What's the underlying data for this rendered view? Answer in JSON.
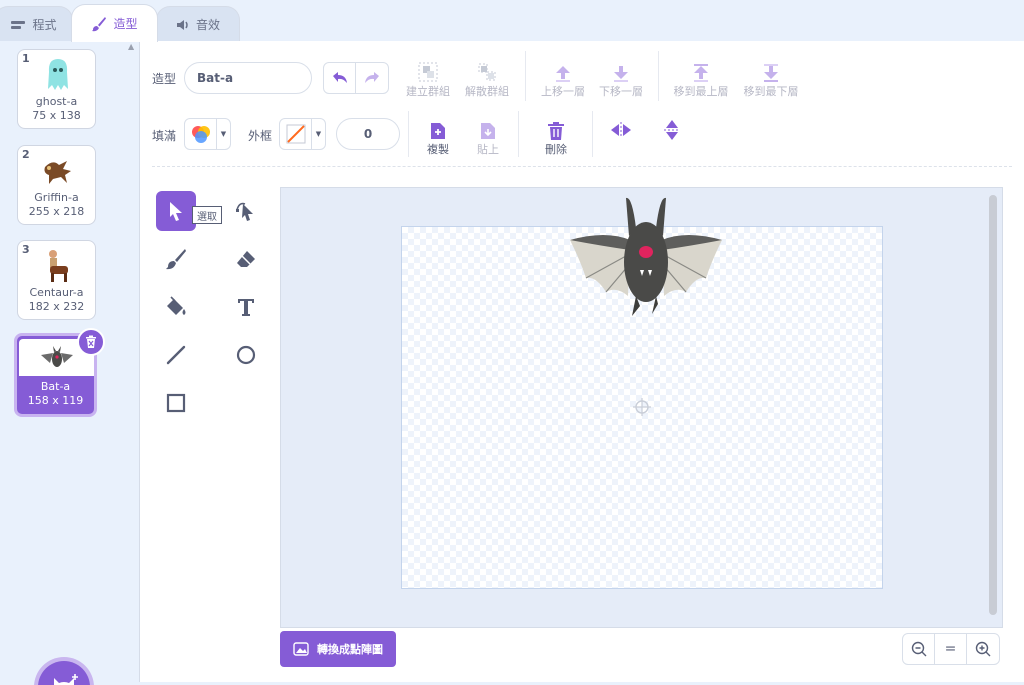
{
  "tabs": [
    {
      "label": "程式",
      "icon": "code-icon"
    },
    {
      "label": "造型",
      "icon": "brush-icon"
    },
    {
      "label": "音效",
      "icon": "speaker-icon"
    }
  ],
  "costumes": [
    {
      "num": "1",
      "name": "ghost-a",
      "size": "75 x 138"
    },
    {
      "num": "2",
      "name": "Griffin-a",
      "size": "255 x 218"
    },
    {
      "num": "3",
      "name": "Centaur-a",
      "size": "182 x 232"
    },
    {
      "num": "4",
      "name": "Bat-a",
      "size": "158 x 119"
    }
  ],
  "selected_costume_index": 3,
  "editor": {
    "costume_label": "造型",
    "costume_name": "Bat-a",
    "fill_label": "填滿",
    "outline_label": "外框",
    "outline_width": "0",
    "group": "建立群組",
    "ungroup": "解散群組",
    "forward": "上移一層",
    "backward": "下移一層",
    "front": "移到最上層",
    "back": "移到最下層",
    "copy": "複製",
    "paste": "貼上",
    "delete": "刪除",
    "tooltip": "選取",
    "convert": "轉換成點陣圖",
    "zoom_reset": "="
  },
  "colors": {
    "accent": "#855cd6",
    "canvas_bg": "#e5ecf8"
  }
}
